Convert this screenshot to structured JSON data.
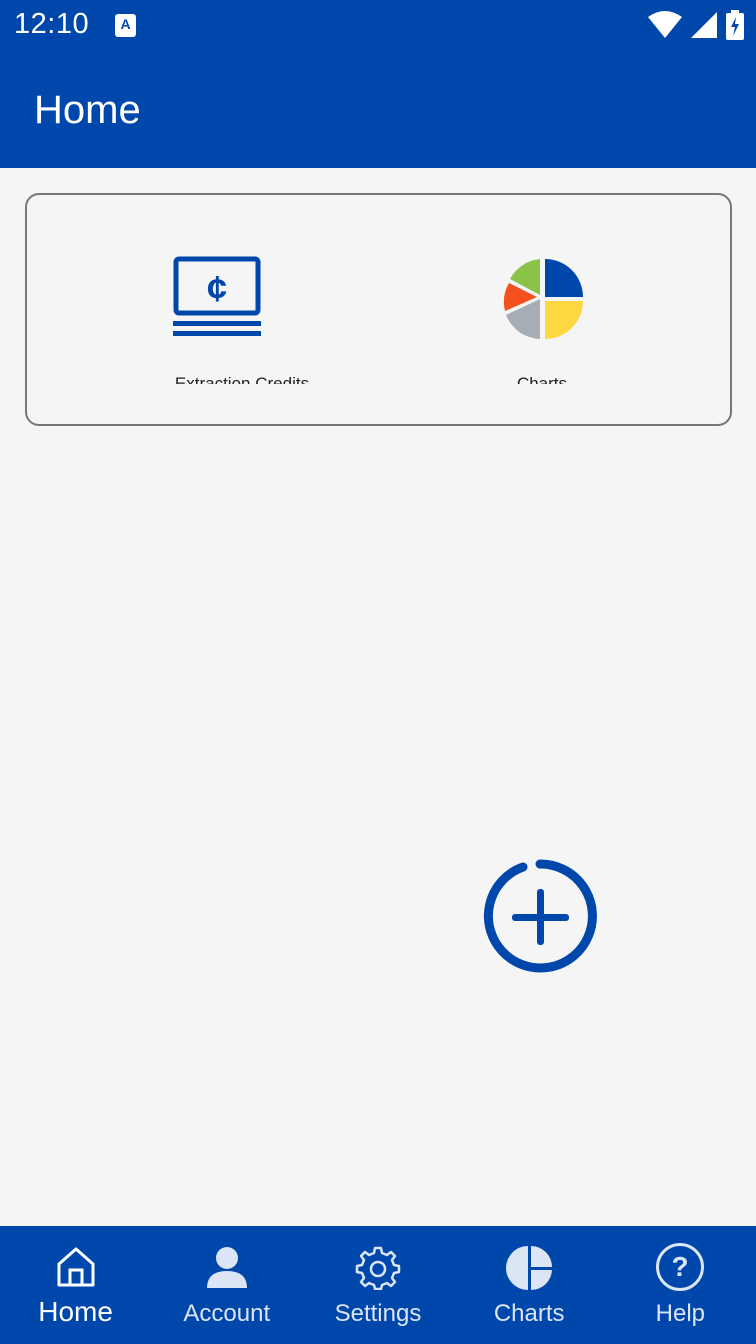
{
  "status_bar": {
    "time": "12:10",
    "notification_icon": "a-icon",
    "wifi_icon": "wifi-icon",
    "signal_icon": "signal-icon",
    "battery_icon": "battery-charging-icon"
  },
  "app_bar": {
    "title": "Home"
  },
  "tiles": [
    {
      "label": "Extraction Credits",
      "icon": "credits-icon"
    },
    {
      "label": "Charts",
      "icon": "pie-chart-icon"
    }
  ],
  "fab": {
    "icon": "add-circle-icon"
  },
  "bottom_nav": {
    "items": [
      {
        "label": "Home",
        "icon": "home-icon",
        "active": true
      },
      {
        "label": "Account",
        "icon": "person-icon",
        "active": false
      },
      {
        "label": "Settings",
        "icon": "gear-icon",
        "active": false
      },
      {
        "label": "Charts",
        "icon": "pie-chart-icon",
        "active": false
      },
      {
        "label": "Help",
        "icon": "help-icon",
        "active": false
      }
    ]
  },
  "colors": {
    "primary": "#0047ab",
    "background": "#f5f5f5",
    "pie_green": "#8bc34a",
    "pie_red": "#f4511e",
    "pie_grey": "#a7adb4",
    "pie_yellow": "#ffd740"
  }
}
